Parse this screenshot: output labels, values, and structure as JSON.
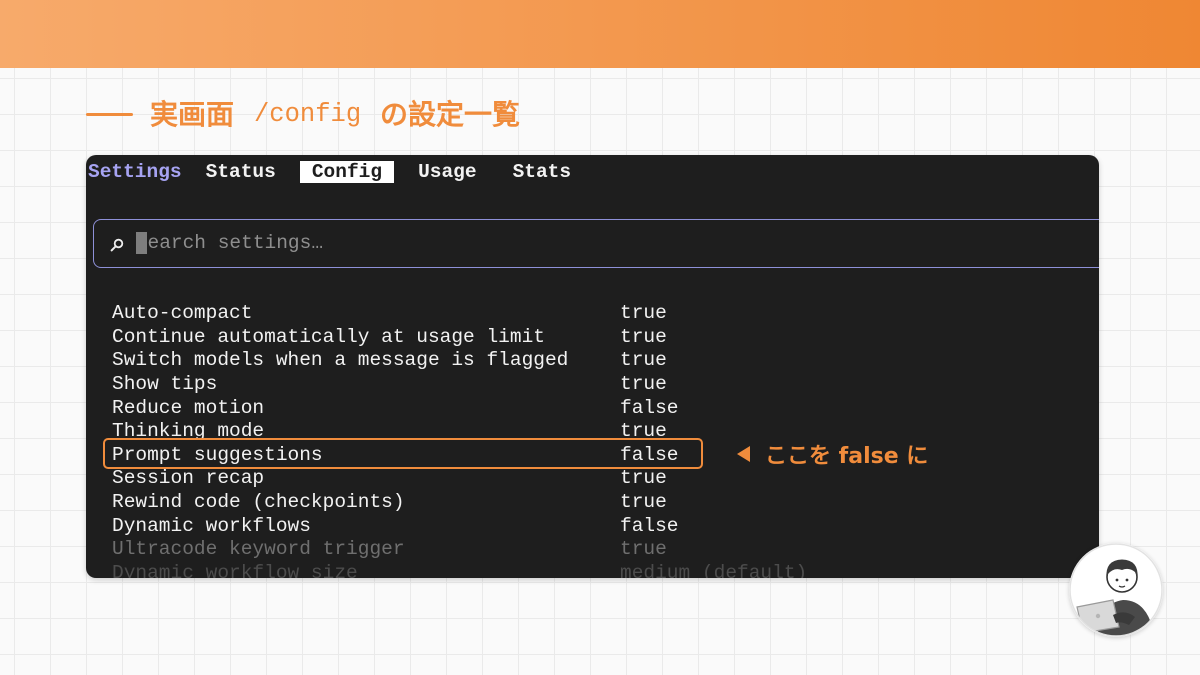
{
  "theme": {
    "accent": "#F08C3C",
    "header_start": "#F7AA6B",
    "header_end": "#EF8733",
    "terminal_bg": "#1E1E1E",
    "terminal_title": "#A6A3F2",
    "search_border": "#8E90D8"
  },
  "heading": {
    "prefix": "実画面",
    "code": "/config",
    "suffix": "の設定一覧"
  },
  "terminal": {
    "title": "Settings",
    "tabs": [
      {
        "label": "Status",
        "active": false
      },
      {
        "label": "Config",
        "active": true
      },
      {
        "label": "Usage",
        "active": false
      },
      {
        "label": "Stats",
        "active": false
      }
    ],
    "search": {
      "icon": "search-icon",
      "placeholder": "earch settings…"
    },
    "settings": [
      {
        "name": "Auto-compact",
        "value": "true"
      },
      {
        "name": "Continue automatically at usage limit",
        "value": "true"
      },
      {
        "name": "Switch models when a message is flagged",
        "value": "true"
      },
      {
        "name": "Show tips",
        "value": "true"
      },
      {
        "name": "Reduce motion",
        "value": "false"
      },
      {
        "name": "Thinking mode",
        "value": "true"
      },
      {
        "name": "Prompt suggestions",
        "value": "false",
        "highlighted": true
      },
      {
        "name": "Session recap",
        "value": "true"
      },
      {
        "name": "Rewind code (checkpoints)",
        "value": "true"
      },
      {
        "name": "Dynamic workflows",
        "value": "false"
      },
      {
        "name": "Ultracode keyword trigger",
        "value": "true",
        "dimmed": true
      },
      {
        "name": "Dynamic workflow size",
        "value": "medium (default)",
        "dimmed": true
      }
    ]
  },
  "annotation": {
    "icon": "pointer-triangle-icon",
    "text": "ここを false に"
  },
  "avatar": {
    "icon": "person-with-laptop-icon"
  }
}
